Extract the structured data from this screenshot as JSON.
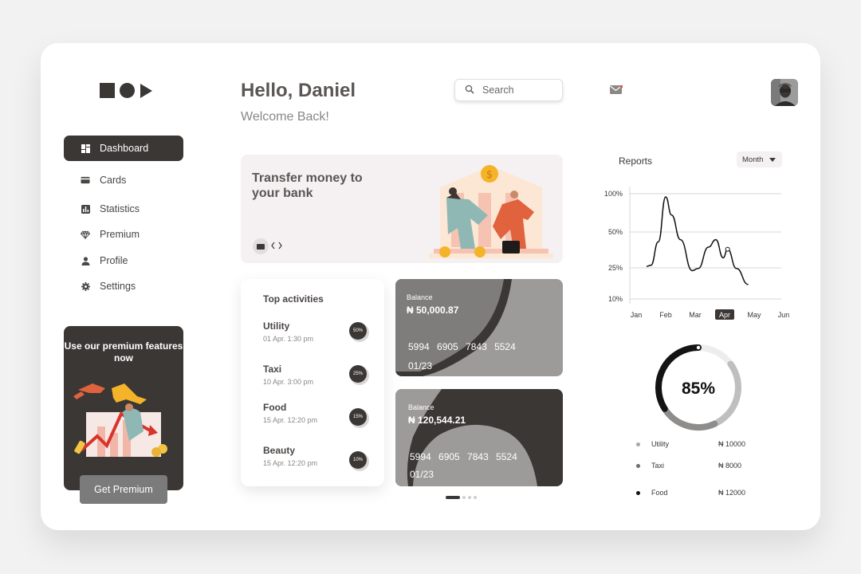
{
  "sidebar": {
    "items": [
      {
        "label": "Dashboard",
        "icon": "dashboard-icon"
      },
      {
        "label": "Cards",
        "icon": "card-icon"
      },
      {
        "label": "Statistics",
        "icon": "bar-chart-icon"
      },
      {
        "label": "Premium",
        "icon": "diamond-icon"
      },
      {
        "label": "Profile",
        "icon": "person-icon"
      },
      {
        "label": "Settings",
        "icon": "gear-icon"
      }
    ],
    "premium": {
      "title": "Use our premium features now",
      "button": "Get Premium"
    }
  },
  "header": {
    "greeting": "Hello, Daniel",
    "welcome": "Welcome Back!",
    "search_placeholder": "Search"
  },
  "banner": {
    "title": "Transfer money to your bank"
  },
  "activities": {
    "title": "Top activities",
    "items": [
      {
        "name": "Utility",
        "date": "01 Apr. 1:30 pm",
        "percent": "50%"
      },
      {
        "name": "Taxi",
        "date": "10 Apr. 3:00 pm",
        "percent": "25%"
      },
      {
        "name": "Food",
        "date": "15 Apr. 12:20 pm",
        "percent": "15%"
      },
      {
        "name": "Beauty",
        "date": "15 Apr. 12:20 pm",
        "percent": "10%"
      }
    ]
  },
  "cards": [
    {
      "label": "Balance",
      "amount": "₦ 50,000.87",
      "number": "5994 6905 7843 5524",
      "expiry": "01/23"
    },
    {
      "label": "Balance",
      "amount": "₦ 120,544.21",
      "number": "5994 6905 7843 5524",
      "expiry": "01/23"
    }
  ],
  "reports": {
    "title": "Reports",
    "period": "Month"
  },
  "chart_data": [
    {
      "type": "line",
      "title": "Reports",
      "categories": [
        "Jan",
        "Feb",
        "Mar",
        "Apr",
        "May",
        "Jun"
      ],
      "highlighted_category": "Apr",
      "y_ticks": [
        "100%",
        "50%",
        "25%",
        "10%"
      ],
      "series": [
        {
          "x": [
            0.35,
            0.5,
            0.75,
            1.0,
            1.2,
            1.5,
            1.9,
            2.1,
            2.45,
            2.7,
            2.95,
            3.1,
            3.4,
            3.8
          ],
          "y": [
            32,
            33,
            55,
            97,
            80,
            57,
            28,
            30,
            50,
            57,
            40,
            48,
            30,
            15
          ]
        }
      ],
      "grid": true
    },
    {
      "type": "pie",
      "center_label": "85%",
      "categories": [
        "Utility",
        "Taxi",
        "Food"
      ],
      "values": [
        10000,
        8000,
        12000
      ],
      "value_labels": [
        "₦ 10000",
        "₦ 8000",
        "₦ 12000"
      ],
      "colors": [
        "#bfbfbf",
        "#8f8d8c",
        "#141313"
      ]
    }
  ]
}
